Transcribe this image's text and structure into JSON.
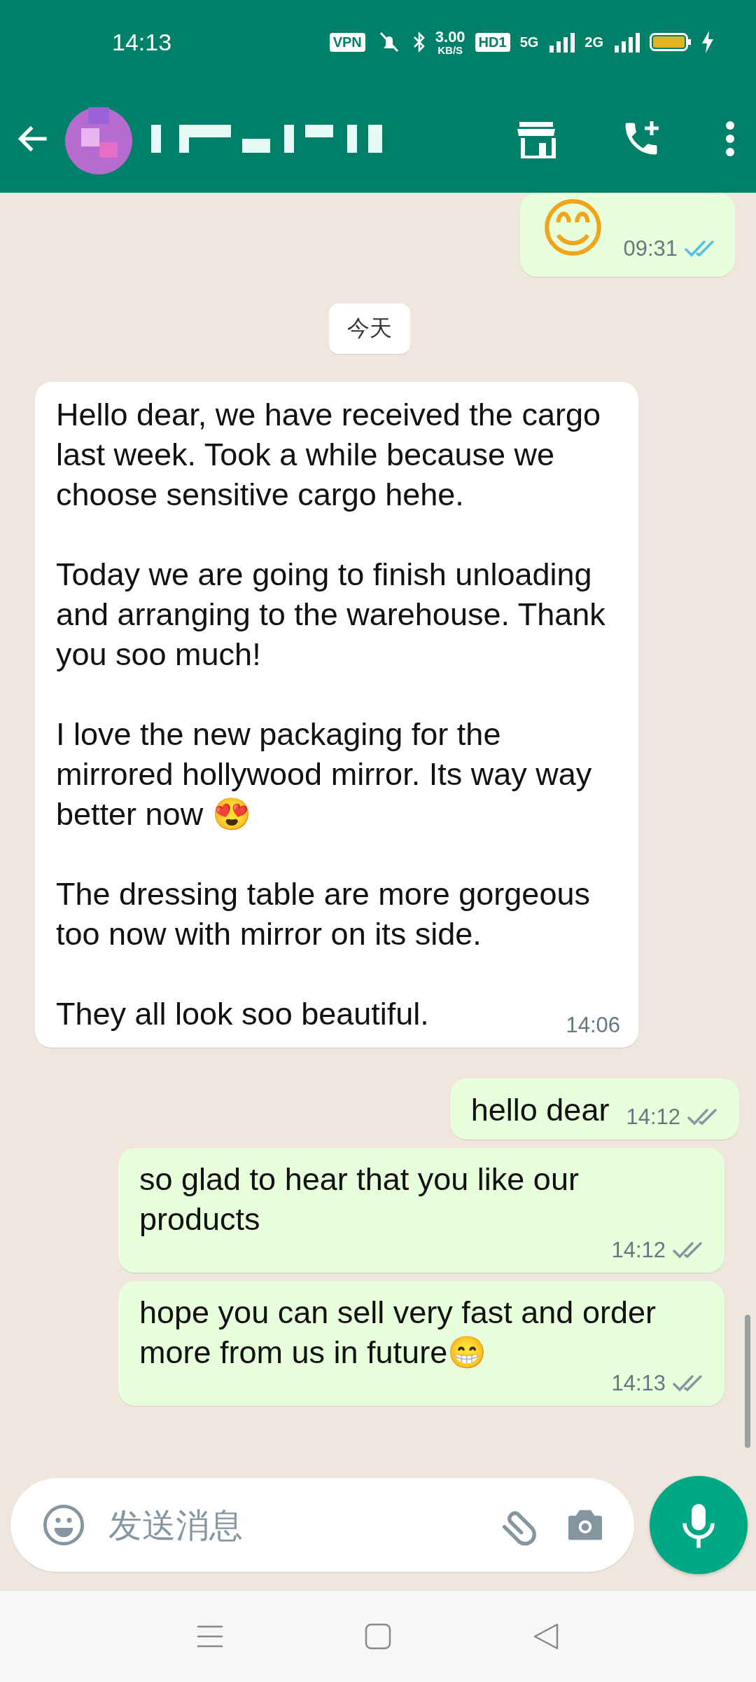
{
  "status_bar": {
    "time": "14:13",
    "vpn": "VPN",
    "speed": "3.00",
    "speed_unit": "KB/S",
    "hd": "HD1",
    "network_1": "5G",
    "network_2": "2G"
  },
  "messages": [
    {
      "kind": "outgoing",
      "emoji": "😊",
      "time": "09:31",
      "read": true
    },
    {
      "kind": "date",
      "label": "今天"
    },
    {
      "kind": "incoming",
      "time": "14:06",
      "paragraphs": [
        "Hello dear, we have received the cargo last week. Took a while because we choose sensitive cargo hehe.",
        "Today we are going to finish unloading and arranging to the warehouse. Thank you soo much!",
        "I love the new packaging for the mirrored hollywood mirror. Its way way better now 😍",
        "The dressing table are more gorgeous too now with mirror on its side.",
        "They all look soo beautiful."
      ]
    },
    {
      "kind": "outgoing",
      "text": "hello dear",
      "time": "14:12",
      "read": false,
      "inline_time": true
    },
    {
      "kind": "outgoing",
      "text": "so glad to hear that you like our products",
      "time": "14:12",
      "read": false,
      "inline_time": false
    },
    {
      "kind": "outgoing",
      "text": "hope you can sell very fast and order more from us in future😁",
      "time": "14:13",
      "read": false,
      "inline_time": false
    }
  ],
  "composer": {
    "placeholder": "发送消息"
  }
}
